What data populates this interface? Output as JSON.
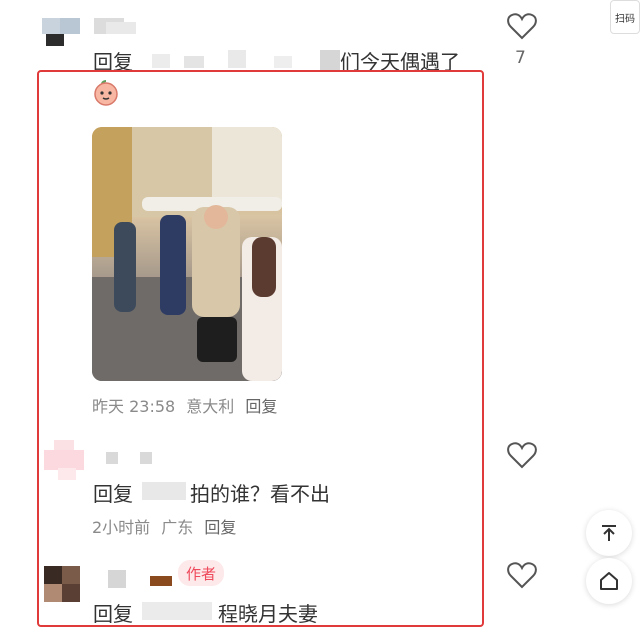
{
  "scan_tag": "扫码",
  "comments": [
    {
      "reply_prefix": "回复",
      "reply_suffix": "们今天偶遇了",
      "like_count": "7"
    },
    {
      "time": "昨天 23:58",
      "location": "意大利",
      "reply_label": "回复"
    },
    {
      "reply_prefix": "回复",
      "reply_suffix": "拍的谁？看不出",
      "time": "2小时前",
      "location": "广东",
      "reply_label": "回复"
    },
    {
      "author_badge": "作者",
      "reply_prefix": "回复",
      "reply_suffix": "程晓月夫妻"
    }
  ],
  "icons": [
    "heart-icon",
    "peach-emoji-icon",
    "scroll-top-icon",
    "home-icon"
  ],
  "colors": {
    "highlight": "#e03a3a",
    "author_badge_text": "#ef4a5c",
    "author_badge_bg": "#fde8ea"
  }
}
